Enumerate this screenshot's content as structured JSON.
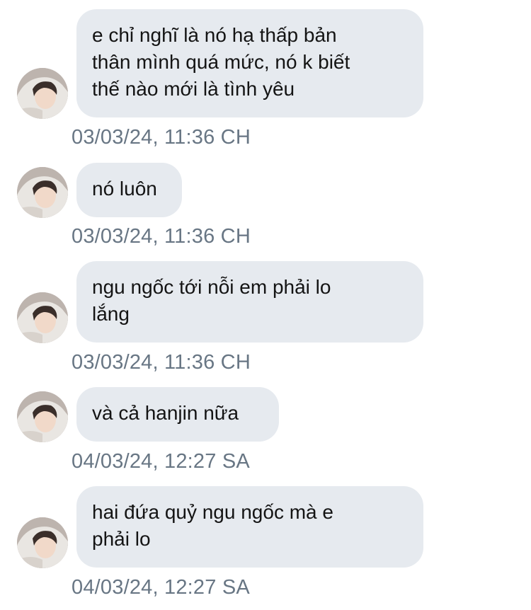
{
  "messages": [
    {
      "text": "e chỉ nghĩ là nó hạ thấp bản\nthân mình quá mức, nó k biết\nthế nào mới là tình yêu",
      "timestamp": "03/03/24, 11:36 CH"
    },
    {
      "text": "nó luôn",
      "timestamp": "03/03/24, 11:36 CH"
    },
    {
      "text": "ngu ngốc tới nỗi em phải lo\nlắng",
      "timestamp": "03/03/24, 11:36 CH"
    },
    {
      "text": "và cả hanjin nữa",
      "timestamp": "04/03/24, 12:27 SA"
    },
    {
      "text": "hai đứa quỷ ngu ngốc mà e\nphải lo",
      "timestamp": "04/03/24, 12:27 SA"
    }
  ],
  "colors": {
    "bubble": "#e6eaef",
    "text": "#141414",
    "timestamp": "#687684"
  },
  "avatar": "profile-photo"
}
